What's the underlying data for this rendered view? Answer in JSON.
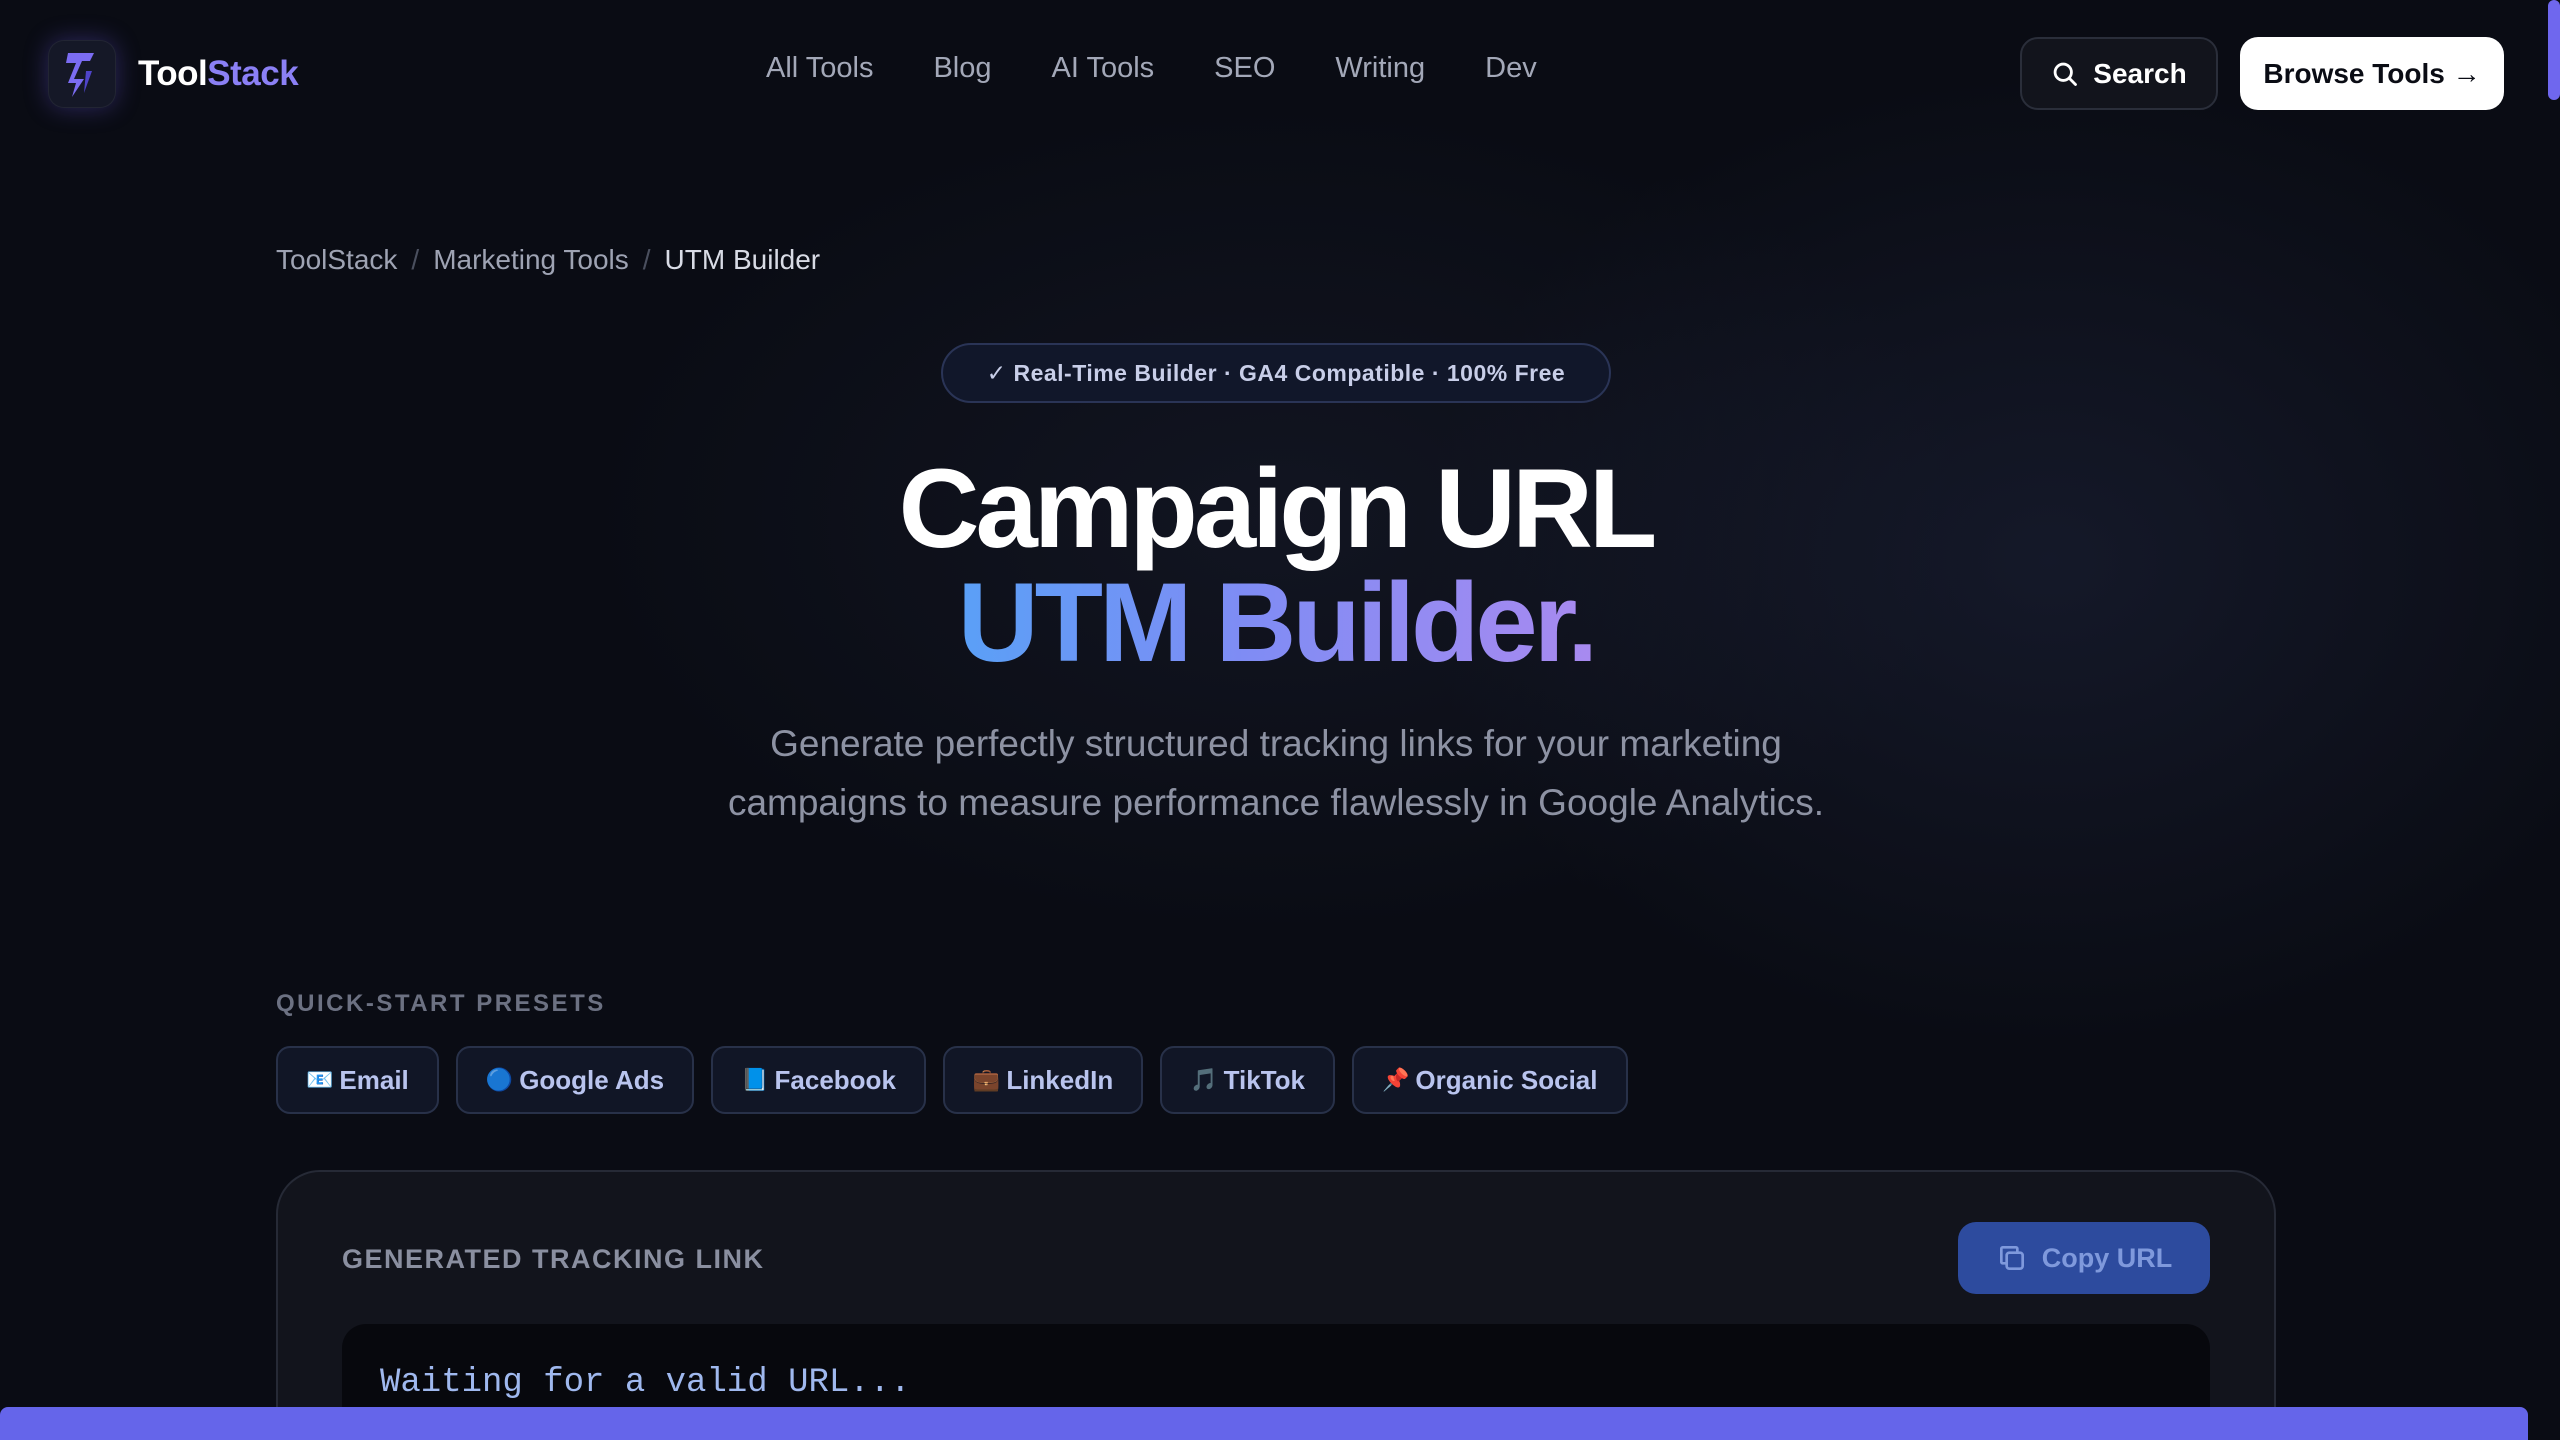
{
  "brand": {
    "name_a": "Tool",
    "name_b": "Stack",
    "logo_icon": "lightning-icon",
    "accent": "#8b80f5"
  },
  "nav": {
    "links": [
      "All Tools",
      "Blog",
      "AI Tools",
      "SEO",
      "Writing",
      "Dev"
    ],
    "search_label": "Search",
    "browse_label": "Browse Tools →"
  },
  "breadcrumb": [
    "ToolStack",
    "Marketing Tools",
    "UTM Builder"
  ],
  "hero": {
    "badge": "✓ Real-Time Builder · GA4 Compatible · 100% Free",
    "title_line1": "Campaign URL",
    "title_line2": "UTM Builder.",
    "subtitle": "Generate perfectly structured tracking links for your marketing campaigns to measure performance flawlessly in Google Analytics."
  },
  "presets": {
    "label": "QUICK-START PRESETS",
    "items": [
      {
        "emoji": "📧",
        "label": "Email"
      },
      {
        "emoji": "🔵",
        "label": "Google Ads"
      },
      {
        "emoji": "📘",
        "label": "Facebook"
      },
      {
        "emoji": "💼",
        "label": "LinkedIn"
      },
      {
        "emoji": "🎵",
        "label": "TikTok"
      },
      {
        "emoji": "📌",
        "label": "Organic Social"
      }
    ]
  },
  "output": {
    "label": "GENERATED TRACKING LINK",
    "copy_label": "Copy URL",
    "placeholder_text": "Waiting for a valid URL..."
  }
}
